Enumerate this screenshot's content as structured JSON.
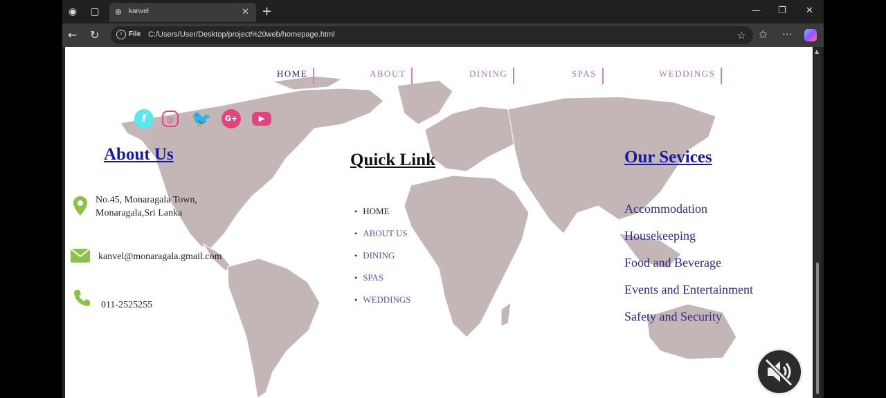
{
  "browser": {
    "tab_title": "kanvel",
    "new_tab_symbol": "+",
    "file_label": "File",
    "url": "C:/Users/User/Desktop/project%20web/homepage.html"
  },
  "nav": [
    "HOME",
    "ABOUT",
    "DINING",
    "SPAS",
    "WEDDINGS"
  ],
  "social": [
    "facebook-icon",
    "instagram-icon",
    "twitter-icon",
    "google-plus-icon",
    "youtube-icon"
  ],
  "about": {
    "heading": "About Us",
    "address_line1": "No.45, Monaragala Town,",
    "address_line2": "Monaragala,Sri Lanka",
    "email": "kanvel@monaragala.gmail.com",
    "phone": "011-2525255"
  },
  "quick_link": {
    "heading": "Quick Link",
    "items": [
      "HOME",
      "ABOUT US",
      "DINING",
      "SPAS",
      "WEDDINGS"
    ]
  },
  "services": {
    "heading": "Our Sevices",
    "items": [
      "Accommodation",
      "Housekeeping",
      "Food and Beverage",
      "Events and Entertainment",
      "Safety and Security"
    ]
  },
  "colors": {
    "heading_blue": "#1a1aa0",
    "icon_green": "#8bc34a",
    "menu_border": "#d27ecf",
    "map_fill": "#c4b6b6"
  }
}
